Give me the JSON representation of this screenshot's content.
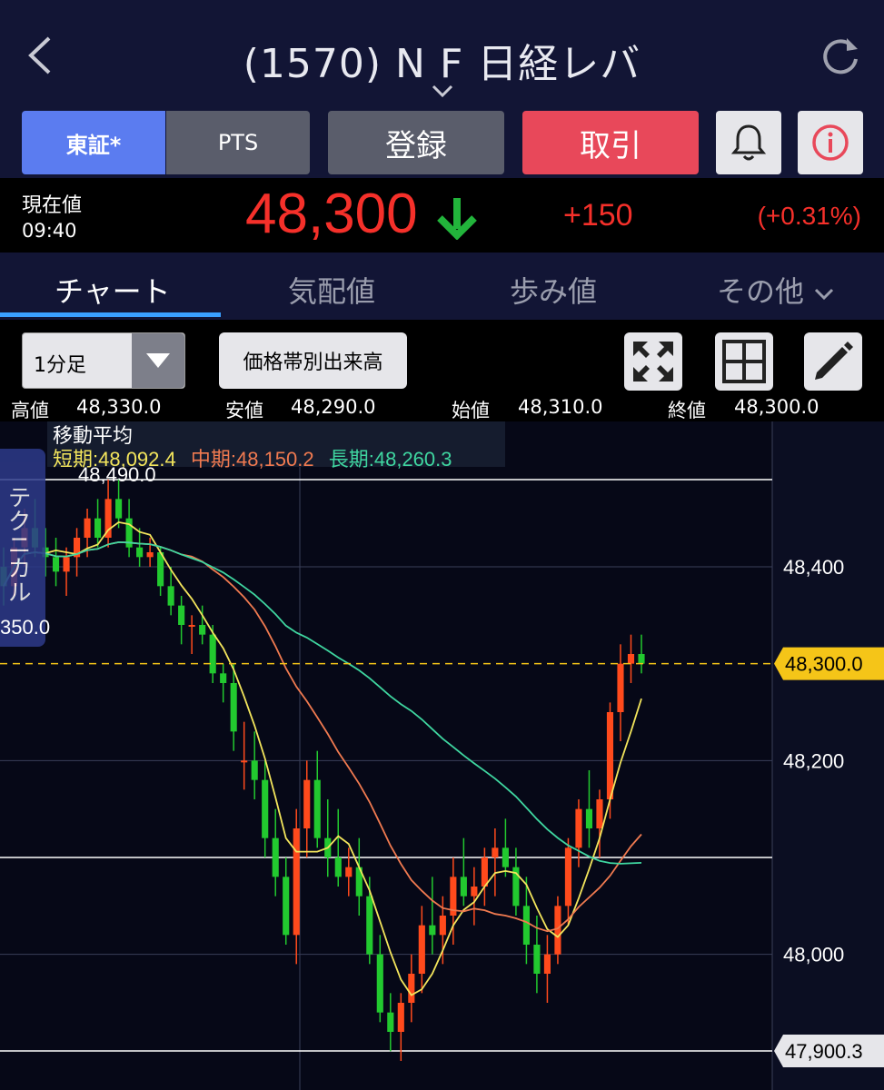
{
  "header": {
    "title": "(1570) N F 日経レバ",
    "back_icon": "chevron-left-icon",
    "refresh_icon": "refresh-icon",
    "dropdown_icon": "chevron-down-icon"
  },
  "buttons": {
    "tosho": "東証*",
    "pts": "PTS",
    "register": "登録",
    "trade": "取引",
    "bell_icon": "bell-icon",
    "info_icon": "info-icon"
  },
  "price": {
    "label": "現在値",
    "time": "09:40",
    "current": "48,300",
    "direction": "down",
    "change": "+150",
    "change_pct": "(+0.31%)"
  },
  "tabs": [
    {
      "label": "チャート",
      "active": true
    },
    {
      "label": "気配値",
      "active": false
    },
    {
      "label": "歩み値",
      "active": false
    },
    {
      "label": "その他",
      "active": false
    }
  ],
  "toolbar": {
    "period": "1分足",
    "volume_profile": "価格帯別出来高",
    "tools": [
      "fullscreen-icon",
      "grid-icon",
      "pencil-icon"
    ]
  },
  "ohlc": {
    "high_label": "高値",
    "high": "48,330.0",
    "low_label": "安値",
    "low": "48,290.0",
    "open_label": "始値",
    "open": "48,310.0",
    "close_label": "終値",
    "close": "48,300.0"
  },
  "moving_average": {
    "title": "移動平均",
    "short": "短期:48,092.4",
    "mid": "中期:48,150.2",
    "long": "長期:48,260.3",
    "colors": {
      "short": "#f3e55c",
      "mid": "#f07a50",
      "long": "#3fd6a0"
    }
  },
  "technical": {
    "label": "テクニカル",
    "value": "350.0"
  },
  "chart_data": {
    "type": "candlestick",
    "high_label": "48,490.0",
    "y_ticks": [
      "48,400",
      "48,200",
      "48,000"
    ],
    "current_price_tag": "48,300.0",
    "low_tag": "47,900.3",
    "y_min": 47860,
    "y_max": 48550,
    "candles": [
      [
        48400,
        48420,
        48360,
        48380
      ],
      [
        48380,
        48430,
        48370,
        48420
      ],
      [
        48420,
        48460,
        48400,
        48440
      ],
      [
        48440,
        48470,
        48410,
        48420
      ],
      [
        48420,
        48440,
        48390,
        48410
      ],
      [
        48410,
        48430,
        48380,
        48395
      ],
      [
        48395,
        48420,
        48370,
        48410
      ],
      [
        48410,
        48440,
        48390,
        48430
      ],
      [
        48430,
        48460,
        48410,
        48450
      ],
      [
        48450,
        48470,
        48420,
        48430
      ],
      [
        48430,
        48490,
        48420,
        48470
      ],
      [
        48470,
        48490,
        48440,
        48450
      ],
      [
        48450,
        48470,
        48410,
        48420
      ],
      [
        48420,
        48440,
        48400,
        48410
      ],
      [
        48410,
        48430,
        48400,
        48415
      ],
      [
        48415,
        48420,
        48370,
        48380
      ],
      [
        48380,
        48400,
        48350,
        48360
      ],
      [
        48360,
        48370,
        48320,
        48340
      ],
      [
        48340,
        48350,
        48310,
        48340
      ],
      [
        48340,
        48360,
        48320,
        48330
      ],
      [
        48330,
        48340,
        48280,
        48290
      ],
      [
        48290,
        48300,
        48260,
        48280
      ],
      [
        48280,
        48300,
        48210,
        48230
      ],
      [
        48200,
        48240,
        48170,
        48200
      ],
      [
        48200,
        48230,
        48160,
        48180
      ],
      [
        48180,
        48200,
        48100,
        48120
      ],
      [
        48120,
        48150,
        48060,
        48080
      ],
      [
        48080,
        48100,
        48010,
        48020
      ],
      [
        48020,
        48150,
        47990,
        48130
      ],
      [
        48130,
        48200,
        48100,
        48180
      ],
      [
        48180,
        48210,
        48110,
        48120
      ],
      [
        48120,
        48160,
        48080,
        48100
      ],
      [
        48100,
        48150,
        48070,
        48080
      ],
      [
        48080,
        48110,
        48060,
        48090
      ],
      [
        48090,
        48120,
        48040,
        48060
      ],
      [
        48060,
        48080,
        47990,
        48000
      ],
      [
        48000,
        48020,
        47930,
        47940
      ],
      [
        47940,
        47960,
        47900,
        47920
      ],
      [
        47920,
        47960,
        47890,
        47950
      ],
      [
        47950,
        48000,
        47930,
        47980
      ],
      [
        47980,
        48050,
        47960,
        48030
      ],
      [
        48030,
        48080,
        48000,
        48020
      ],
      [
        48020,
        48060,
        47990,
        48040
      ],
      [
        48040,
        48100,
        48010,
        48080
      ],
      [
        48080,
        48120,
        48050,
        48060
      ],
      [
        48060,
        48090,
        48030,
        48070
      ],
      [
        48070,
        48110,
        48050,
        48100
      ],
      [
        48100,
        48130,
        48060,
        48110
      ],
      [
        48110,
        48140,
        48080,
        48090
      ],
      [
        48090,
        48110,
        48040,
        48050
      ],
      [
        48050,
        48080,
        47990,
        48010
      ],
      [
        48010,
        48040,
        47960,
        47980
      ],
      [
        47980,
        48020,
        47950,
        48000
      ],
      [
        48000,
        48060,
        47990,
        48050
      ],
      [
        48050,
        48120,
        48030,
        48110
      ],
      [
        48110,
        48160,
        48090,
        48150
      ],
      [
        48150,
        48190,
        48110,
        48130
      ],
      [
        48130,
        48170,
        48100,
        48160
      ],
      [
        48160,
        48260,
        48140,
        48250
      ],
      [
        48250,
        48320,
        48220,
        48300
      ],
      [
        48300,
        48330,
        48280,
        48310
      ],
      [
        48310,
        48330,
        48290,
        48300
      ]
    ]
  }
}
